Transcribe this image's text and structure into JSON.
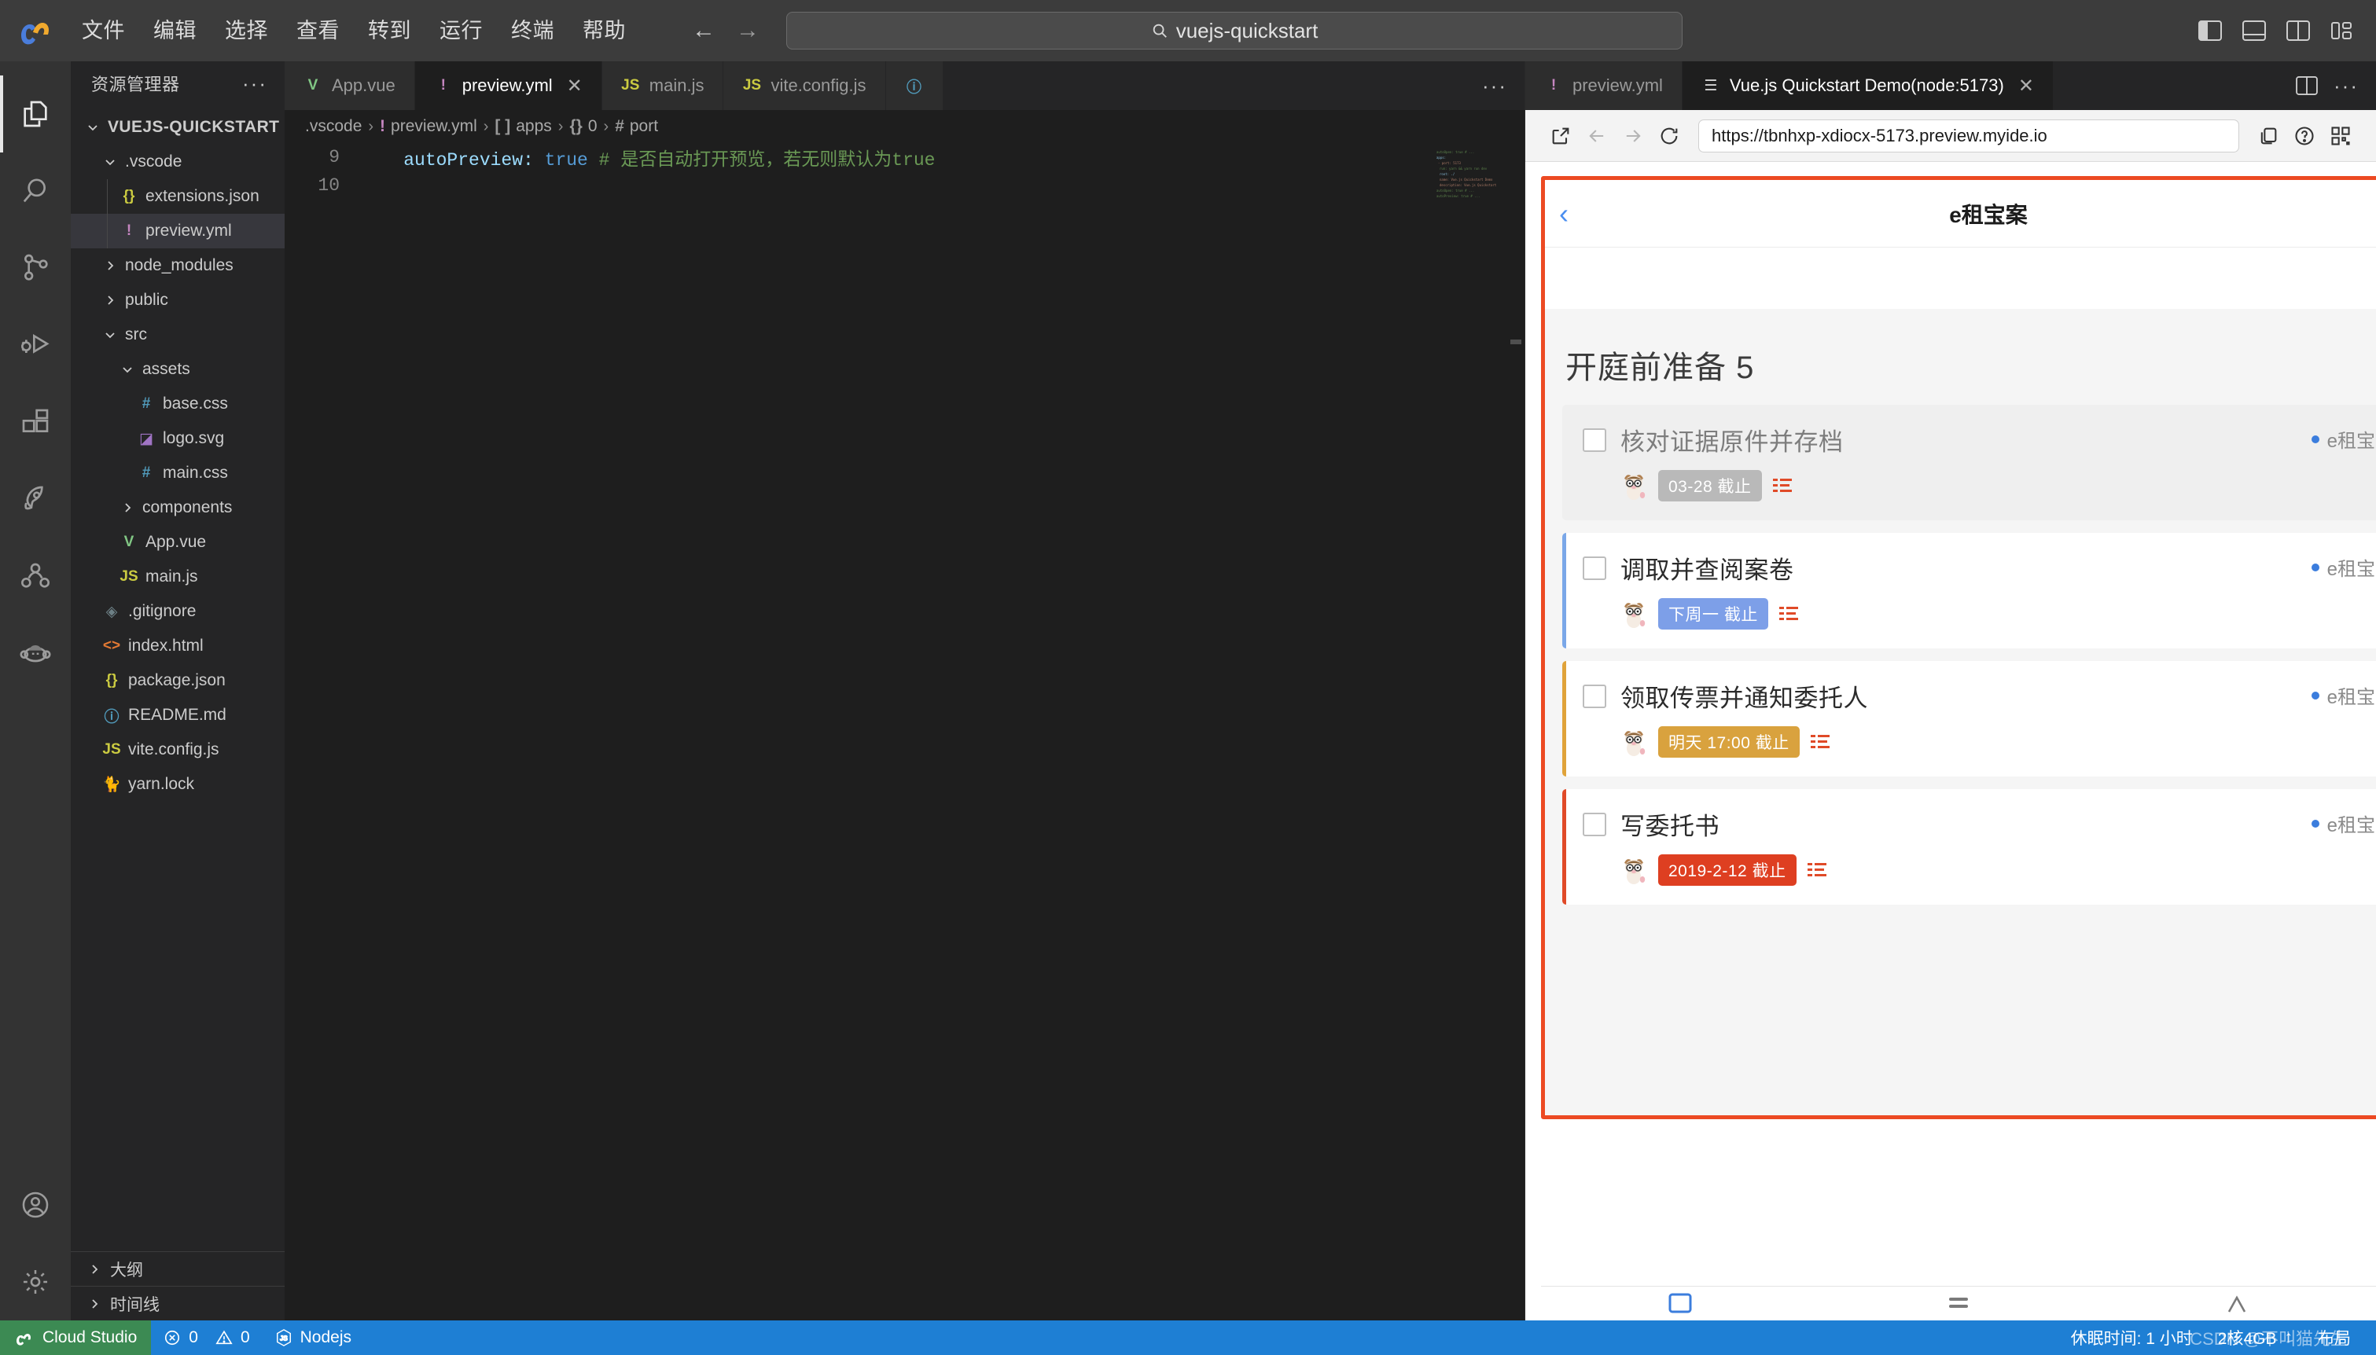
{
  "titlebar": {
    "logo_icon": "cloud-studio-logo-icon",
    "menus": [
      "文件",
      "编辑",
      "选择",
      "查看",
      "转到",
      "运行",
      "终端",
      "帮助"
    ],
    "nav_back_icon": "arrow-left-icon",
    "nav_forward_icon": "arrow-right-icon",
    "quick_search": {
      "icon": "search-icon",
      "value": "vuejs-quickstart"
    },
    "window_controls": [
      {
        "name": "toggle-primary-sidebar-icon",
        "label": "切换主侧边栏"
      },
      {
        "name": "toggle-panel-icon",
        "label": "切换面板"
      },
      {
        "name": "toggle-secondary-sidebar-icon",
        "label": "切换辅助侧边栏"
      },
      {
        "name": "customize-layout-icon",
        "label": "自定义布局"
      }
    ]
  },
  "activitybar": {
    "items": [
      {
        "name": "explorer",
        "icon": "files-icon",
        "active": true
      },
      {
        "name": "search",
        "icon": "search-icon",
        "active": false
      },
      {
        "name": "source-control",
        "icon": "source-control-icon",
        "active": false
      },
      {
        "name": "run-and-debug",
        "icon": "debug-icon",
        "active": false
      },
      {
        "name": "extensions",
        "icon": "extensions-icon",
        "active": false
      },
      {
        "name": "deploy",
        "icon": "rocket-icon",
        "active": false
      },
      {
        "name": "collaboration",
        "icon": "share-nodes-icon",
        "active": false
      },
      {
        "name": "ai-assistant",
        "icon": "monkey-face-icon",
        "active": false
      }
    ],
    "bottom_items": [
      {
        "name": "account",
        "icon": "account-circle-icon"
      },
      {
        "name": "settings",
        "icon": "gear-icon"
      }
    ]
  },
  "sidebar": {
    "title": "资源管理器",
    "more_label": "···",
    "root": {
      "label": "VUEJS-QUICKSTART",
      "expanded": true
    },
    "tree": [
      {
        "label": ".vscode",
        "depth": 1,
        "type": "folder",
        "expanded": true,
        "icon": "chevron-down-icon",
        "selected": false
      },
      {
        "label": "extensions.json",
        "depth": 2,
        "type": "file",
        "icon": "json-icon",
        "glyph": "{}",
        "color": "#cbcb41",
        "selected": false
      },
      {
        "label": "preview.yml",
        "depth": 2,
        "type": "file",
        "icon": "yaml-icon",
        "glyph": "!",
        "color": "#c586c0",
        "selected": true
      },
      {
        "label": "node_modules",
        "depth": 1,
        "type": "folder",
        "expanded": false,
        "icon": "chevron-right-icon",
        "selected": false
      },
      {
        "label": "public",
        "depth": 1,
        "type": "folder",
        "expanded": false,
        "icon": "chevron-right-icon",
        "selected": false
      },
      {
        "label": "src",
        "depth": 1,
        "type": "folder",
        "expanded": true,
        "icon": "chevron-down-icon",
        "selected": false
      },
      {
        "label": "assets",
        "depth": 2,
        "type": "folder",
        "expanded": true,
        "icon": "chevron-down-icon",
        "selected": false
      },
      {
        "label": "base.css",
        "depth": 3,
        "type": "file",
        "icon": "css-icon",
        "glyph": "#",
        "color": "#519aba",
        "selected": false
      },
      {
        "label": "logo.svg",
        "depth": 3,
        "type": "file",
        "icon": "svg-icon",
        "glyph": "◪",
        "color": "#a074c4",
        "selected": false
      },
      {
        "label": "main.css",
        "depth": 3,
        "type": "file",
        "icon": "css-icon",
        "glyph": "#",
        "color": "#519aba",
        "selected": false
      },
      {
        "label": "components",
        "depth": 2,
        "type": "folder",
        "expanded": false,
        "icon": "chevron-right-icon",
        "selected": false
      },
      {
        "label": "App.vue",
        "depth": 2,
        "type": "file",
        "icon": "vue-icon",
        "glyph": "V",
        "color": "#81c784",
        "selected": false
      },
      {
        "label": "main.js",
        "depth": 2,
        "type": "file",
        "icon": "js-icon",
        "glyph": "JS",
        "color": "#cbcb41",
        "selected": false
      },
      {
        "label": ".gitignore",
        "depth": 1,
        "type": "file",
        "icon": "git-icon",
        "glyph": "◈",
        "color": "#6d8086",
        "selected": false
      },
      {
        "label": "index.html",
        "depth": 1,
        "type": "file",
        "icon": "html-icon",
        "glyph": "<>",
        "color": "#e37933",
        "selected": false
      },
      {
        "label": "package.json",
        "depth": 1,
        "type": "file",
        "icon": "json-icon",
        "glyph": "{}",
        "color": "#cbcb41",
        "selected": false
      },
      {
        "label": "README.md",
        "depth": 1,
        "type": "file",
        "icon": "markdown-icon",
        "glyph": "ⓘ",
        "color": "#519aba",
        "selected": false
      },
      {
        "label": "vite.config.js",
        "depth": 1,
        "type": "file",
        "icon": "js-icon",
        "glyph": "JS",
        "color": "#cbcb41",
        "selected": false
      },
      {
        "label": "yarn.lock",
        "depth": 1,
        "type": "file",
        "icon": "yarn-icon",
        "glyph": "🐈",
        "color": "#519aba",
        "selected": false
      }
    ],
    "sections": [
      {
        "label": "大纲",
        "icon": "chevron-right-icon",
        "expanded": false
      },
      {
        "label": "时间线",
        "icon": "chevron-right-icon",
        "expanded": false
      }
    ]
  },
  "editor": {
    "tabs": [
      {
        "label": "App.vue",
        "glyph": "V",
        "color": "#81c784",
        "active": false,
        "closable": false
      },
      {
        "label": "preview.yml",
        "glyph": "!",
        "color": "#c586c0",
        "active": true,
        "closable": true
      },
      {
        "label": "main.js",
        "glyph": "JS",
        "color": "#cbcb41",
        "active": false,
        "closable": false
      },
      {
        "label": "vite.config.js",
        "glyph": "JS",
        "color": "#cbcb41",
        "active": false,
        "closable": false
      },
      {
        "label": "",
        "glyph": "ⓘ",
        "color": "#519aba",
        "active": false,
        "closable": false
      }
    ],
    "tab_more_label": "···",
    "breadcrumb": [
      {
        "label": ".vscode",
        "glyph": "",
        "color": ""
      },
      {
        "label": "preview.yml",
        "glyph": "!",
        "color": "#c586c0"
      },
      {
        "label": "apps",
        "glyph": "[ ]",
        "color": "#9a9a9a"
      },
      {
        "label": "0",
        "glyph": "{}",
        "color": "#9a9a9a"
      },
      {
        "label": "port",
        "glyph": "#",
        "color": "#9a9a9a"
      }
    ],
    "separator": "›",
    "lines": [
      {
        "no": "9",
        "indent": "    ",
        "key": "autoPreview:",
        "value": " true",
        "comment": " # 是否自动打开预览，若无则默认为true"
      },
      {
        "no": "10",
        "indent": "",
        "key": "",
        "value": "",
        "comment": ""
      }
    ]
  },
  "preview": {
    "tabs": [
      {
        "label": "preview.yml",
        "glyph": "!",
        "color": "#c586c0",
        "active": false,
        "closable": false
      },
      {
        "label": "Vue.js Quickstart Demo(node:5173)",
        "glyph": "☰",
        "color": "#d4d4d4",
        "active": true,
        "closable": true
      }
    ],
    "split_icon": "split-editor-icon",
    "more_label": "···",
    "toolbar": {
      "open_external_icon": "open-external-icon",
      "back_icon": "arrow-left-icon",
      "forward_icon": "arrow-right-icon",
      "reload_icon": "reload-icon",
      "url": "https://tbnhxp-xdiocx-5173.preview.myide.io",
      "copy_icon": "copy-icon",
      "help_icon": "help-circle-icon",
      "qrcode_icon": "qrcode-icon"
    }
  },
  "app": {
    "frame_color": "#ec4a23",
    "header": {
      "back_icon": "chevron-left-icon",
      "title": "e租宝案"
    },
    "section_title": "开庭前准备 5",
    "tasks": [
      {
        "name": "核对证据原件并存档",
        "checked": false,
        "done_style": true,
        "accent": "",
        "avatar_icon": "avatar-hamster-icon",
        "badge": {
          "text": "03-28 截止",
          "bg": "#b9b9b9"
        },
        "list_icon": "subtask-list-icon",
        "tag": "e租宝案",
        "tag_dot_color": "#3b7ddd"
      },
      {
        "name": "调取并查阅案卷",
        "checked": false,
        "done_style": false,
        "accent": "#7aa7e8",
        "avatar_icon": "avatar-hamster-icon",
        "badge": {
          "text": "下周一 截止",
          "bg": "#7d9fe8"
        },
        "list_icon": "subtask-list-icon",
        "tag": "e租宝案",
        "tag_dot_color": "#3b7ddd"
      },
      {
        "name": "领取传票并通知委托人",
        "checked": false,
        "done_style": false,
        "accent": "#e0a33a",
        "avatar_icon": "avatar-hamster-icon",
        "badge": {
          "text": "明天 17:00 截止",
          "bg": "#d9a23e"
        },
        "list_icon": "subtask-list-icon",
        "tag": "e租宝案",
        "tag_dot_color": "#3b7ddd"
      },
      {
        "name": "写委托书",
        "checked": false,
        "done_style": false,
        "accent": "#e04a28",
        "avatar_icon": "avatar-hamster-icon",
        "badge": {
          "text": "2019-2-12 截止",
          "bg": "#de3f21"
        },
        "list_icon": "subtask-list-icon",
        "tag": "e租宝案",
        "tag_dot_color": "#3b7ddd"
      }
    ],
    "bottom_tabs": [
      {
        "name": "tasks-tab-icon",
        "active": true
      },
      {
        "name": "list-tab-icon",
        "active": false
      },
      {
        "name": "profile-tab-icon",
        "active": false
      }
    ]
  },
  "statusbar": {
    "cloud_label": "Cloud Studio",
    "cloud_icon": "cloud-studio-icon",
    "errors": {
      "icon": "error-circle-icon",
      "count": "0"
    },
    "warnings": {
      "icon": "warning-triangle-icon",
      "count": "0"
    },
    "runtime": {
      "icon": "nodejs-icon",
      "label": "Nodejs"
    },
    "sleep_time": "休眠时间: 1 小时",
    "spec": "2核4GB",
    "spec_icon": "arrow-up-icon",
    "layout_label": "布局",
    "watermark": "CSDN @不叫猫先生"
  }
}
